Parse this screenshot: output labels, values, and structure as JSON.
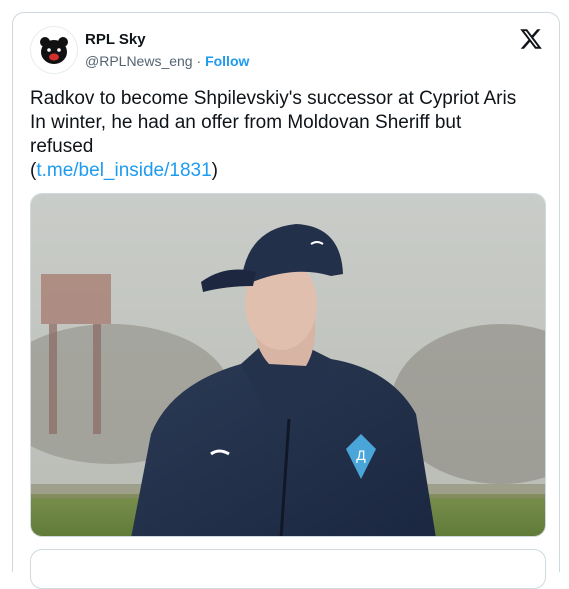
{
  "account": {
    "name": "RPL Sky",
    "handle": "@RPLNews_eng",
    "separator": "·",
    "follow_label": "Follow"
  },
  "tweet": {
    "line1": "Radkov to become Shpilevskiy's successor at Cypriot Aris",
    "line2": "In winter, he had an offer from Moldovan Sheriff but",
    "line3": "refused",
    "link_open": "(",
    "link_text": "t.me/bel_inside/1831",
    "link_close": ")"
  },
  "icons": {
    "avatar": "bear-logo-icon",
    "platform": "x-logo-icon"
  },
  "colors": {
    "accent": "#1d9bf0",
    "text": "#0f1419",
    "muted": "#536471",
    "border": "#cfd9de"
  }
}
